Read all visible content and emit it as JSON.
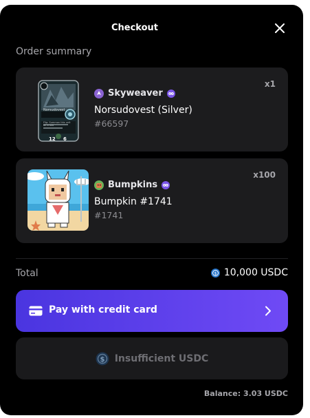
{
  "header": {
    "title": "Checkout",
    "close_icon": "close-icon"
  },
  "order_summary": {
    "label": "Order summary"
  },
  "items": [
    {
      "quantity": "x1",
      "collection": "Skyweaver",
      "collection_icon": "skyweaver-logo-icon",
      "verified_icon": "verified-badge-icon",
      "name": "Norsudovest (Silver)",
      "token_id": "#66597",
      "thumbnail": "skyweaver-card-thumbnail",
      "card_art": {
        "name": "Norsudovest",
        "text": "Flip: Summon this unit on a row",
        "stats": [
          "12",
          "6"
        ]
      }
    },
    {
      "quantity": "x100",
      "collection": "Bumpkins",
      "collection_icon": "bumpkins-logo-icon",
      "verified_icon": "verified-badge-icon",
      "name": "Bumpkin #1741",
      "token_id": "#1741",
      "thumbnail": "bumpkin-character-thumbnail"
    }
  ],
  "total": {
    "label": "Total",
    "value": "10,000 USDC",
    "currency_icon": "usdc-coin-icon"
  },
  "pay_button": {
    "label": "Pay with credit card",
    "icon": "credit-card-icon",
    "chevron": "chevron-right-icon"
  },
  "insufficient_button": {
    "label": "Insufficient USDC",
    "icon": "usdc-coin-icon"
  },
  "balance": {
    "text": "Balance: 3.03 USDC"
  },
  "colors": {
    "accent_start": "#4a35e0",
    "accent_end": "#6f4af5",
    "card_bg": "#1c1c1e",
    "usdc_blue": "#2775ca"
  }
}
